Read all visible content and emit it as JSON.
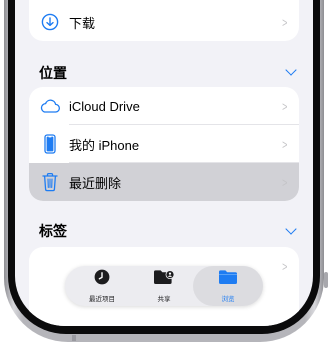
{
  "top_card": {
    "download_label": "下载",
    "download_icon": "arrow-down-circle-icon"
  },
  "locations": {
    "title": "位置",
    "items": [
      {
        "label": "iCloud Drive",
        "icon": "cloud-icon"
      },
      {
        "label": "我的 iPhone",
        "icon": "iphone-icon"
      },
      {
        "label": "最近删除",
        "icon": "trash-icon",
        "selected": true
      }
    ]
  },
  "tags": {
    "title": "标签"
  },
  "tabbar": {
    "tabs": [
      {
        "label": "最近项目",
        "icon": "clock-icon"
      },
      {
        "label": "共享",
        "icon": "shared-folder-icon"
      },
      {
        "label": "浏览",
        "icon": "folder-icon",
        "active": true
      }
    ]
  },
  "colors": {
    "accent": "#1e7cf2",
    "background": "#f2f2f7",
    "selected_row": "#d1d1d6"
  }
}
